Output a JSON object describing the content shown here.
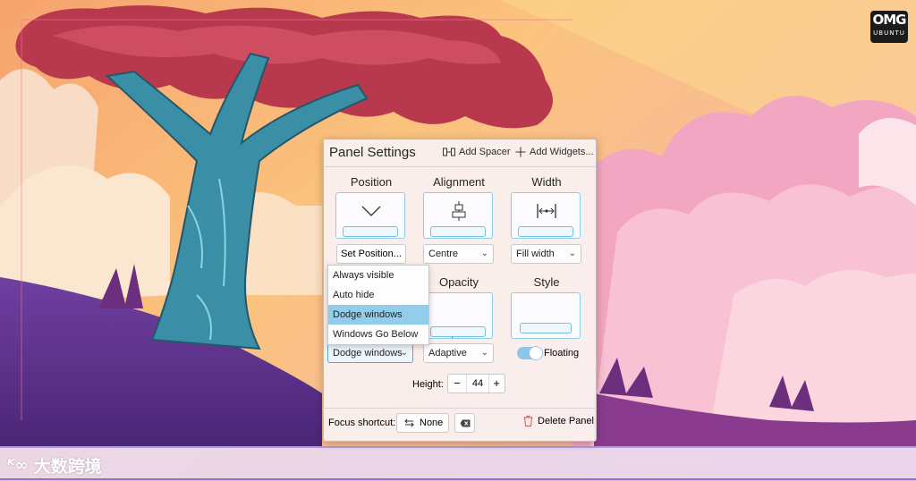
{
  "dialog": {
    "title": "Panel Settings",
    "add_spacer": "Add Spacer",
    "add_widgets": "Add Widgets..."
  },
  "position": {
    "label": "Position",
    "button": "Set Position..."
  },
  "alignment": {
    "label": "Alignment",
    "value": "Centre"
  },
  "width": {
    "label": "Width",
    "value": "Fill width"
  },
  "visibility": {
    "value": "Dodge windows"
  },
  "opacity": {
    "label": "Opacity",
    "value": "Adaptive"
  },
  "style": {
    "label": "Style",
    "floating_label": "Floating",
    "floating_on": true
  },
  "height": {
    "label": "Height:",
    "value": "44"
  },
  "footer": {
    "focus_label": "Focus shortcut:",
    "shortcut_value": "None",
    "delete_label": "Delete Panel"
  },
  "visibility_menu": {
    "items": [
      "Always visible",
      "Auto hide",
      "Dodge windows",
      "Windows Go Below"
    ],
    "selected_index": 2
  },
  "branding": {
    "logo_line1": "OMG",
    "logo_line2": "UBUNTU",
    "watermark": "大数跨境"
  },
  "colors": {
    "accent": "#93cdec",
    "tile_border": "#8fcbe4",
    "delete_icon": "#d0555b"
  }
}
